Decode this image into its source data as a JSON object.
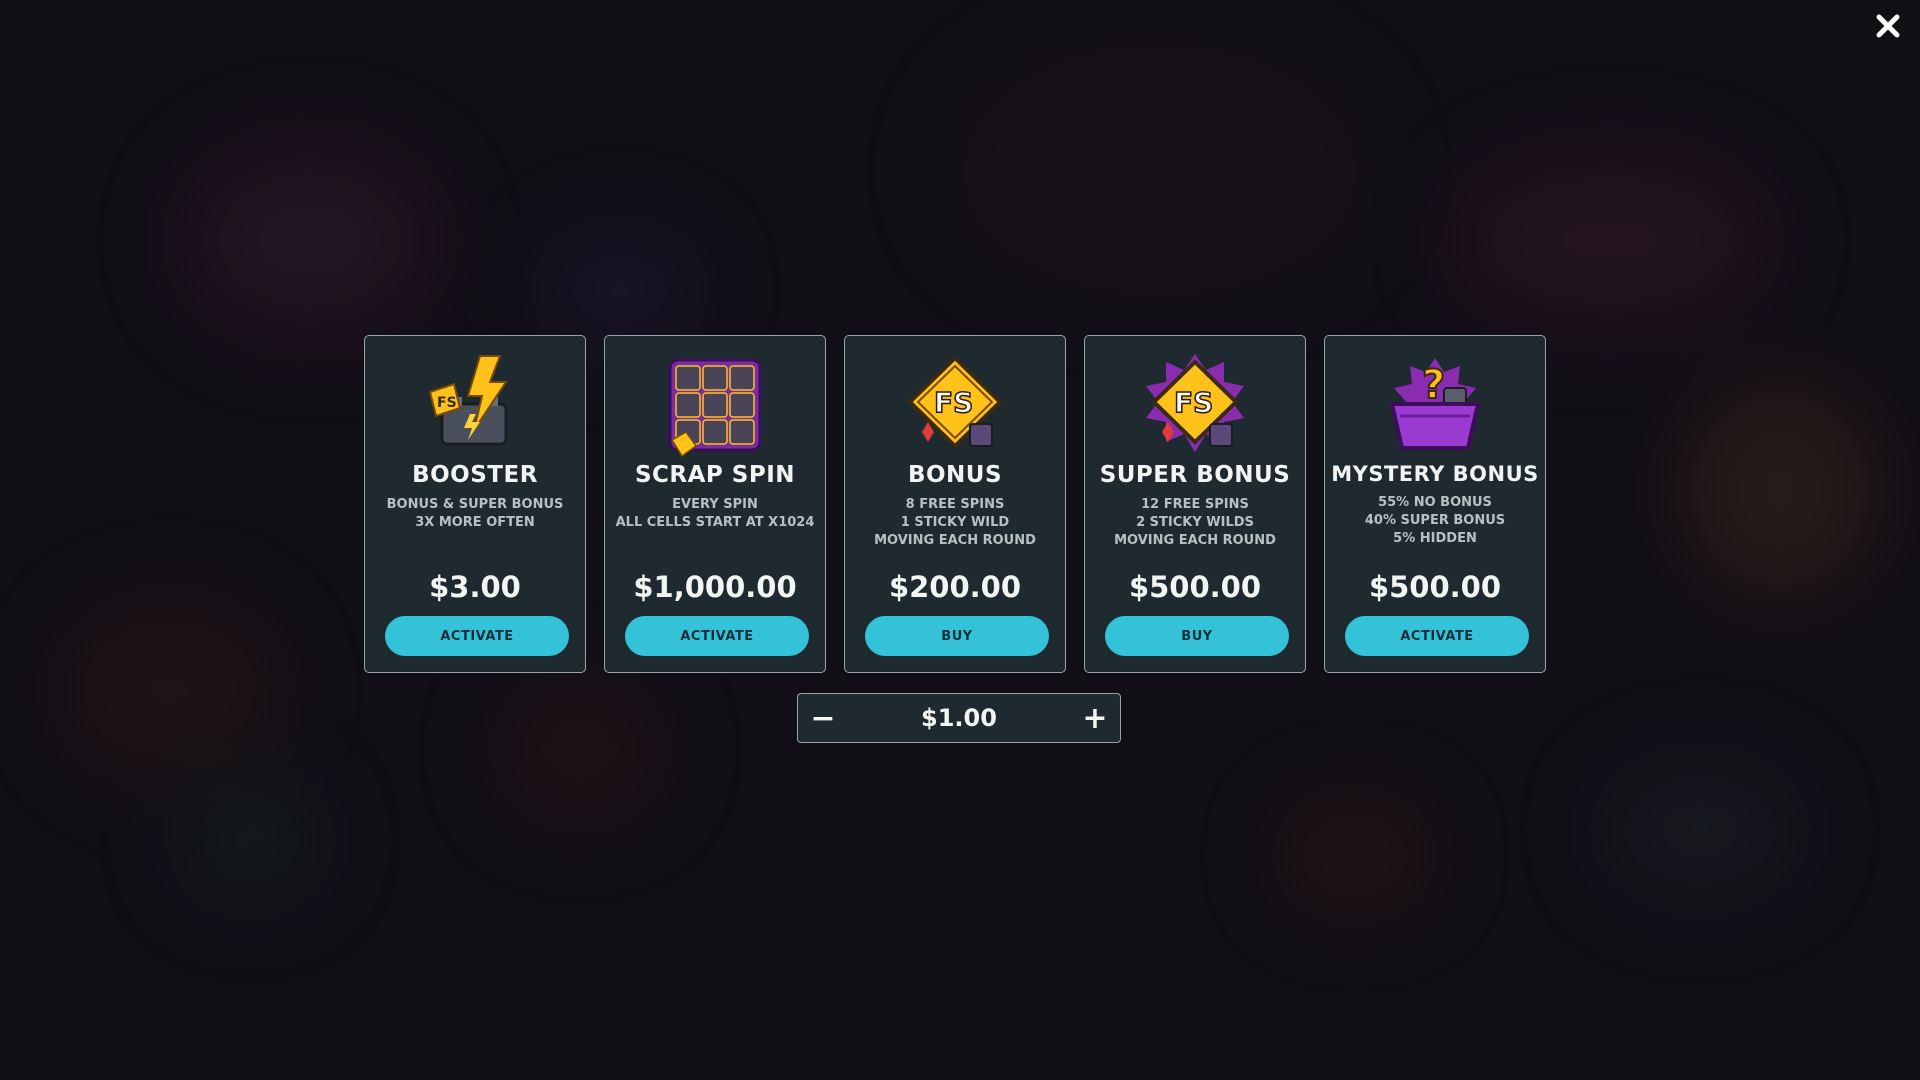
{
  "close": {
    "icon": "close-icon"
  },
  "cards": [
    {
      "icon": "booster-battery-icon",
      "title": "Booster",
      "desc": [
        "Bonus & Super Bonus",
        "3x More Often"
      ],
      "price": "$3.00",
      "button": "Activate"
    },
    {
      "icon": "scrap-spin-grid-icon",
      "title": "Scrap Spin",
      "desc": [
        "Every Spin",
        "All Cells Start at x1024"
      ],
      "price": "$1,000.00",
      "button": "Activate"
    },
    {
      "icon": "fs-sign-icon",
      "title": "Bonus",
      "desc": [
        "8 Free Spins",
        "1 Sticky Wild",
        "Moving Each Round"
      ],
      "price": "$200.00",
      "button": "Buy"
    },
    {
      "icon": "fs-sign-burst-icon",
      "title": "Super Bonus",
      "desc": [
        "12 Free Spins",
        "2 Sticky Wilds",
        "Moving Each Round"
      ],
      "price": "$500.00",
      "button": "Buy"
    },
    {
      "icon": "mystery-bin-icon",
      "title": "Mystery Bonus",
      "desc": [
        "55% No Bonus",
        "40% Super Bonus",
        "5% Hidden"
      ],
      "price": "$500.00",
      "button": "Activate"
    }
  ],
  "bet": {
    "minus": "−",
    "value": "$1.00",
    "plus": "+"
  },
  "colors": {
    "accent": "#33c2d8",
    "card_bg": "#1e2a2f",
    "card_border": "#9aa3a8"
  }
}
